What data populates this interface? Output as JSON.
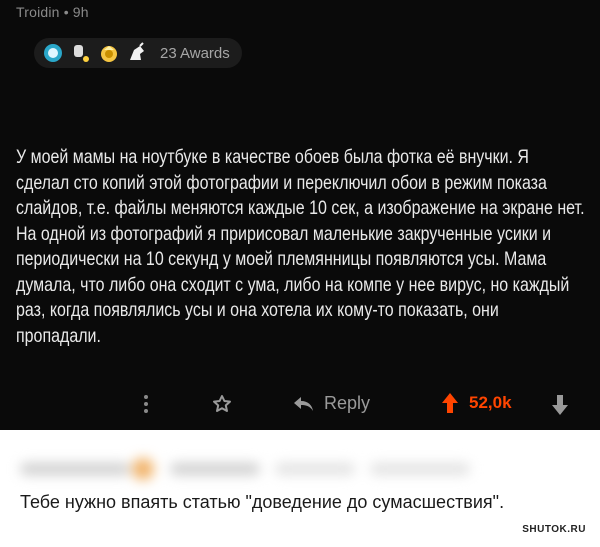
{
  "post": {
    "author": "Troidin",
    "time": "9h",
    "awards_label": "23 Awards",
    "award_icons": [
      "helpful-award-icon",
      "wholesome-award-icon",
      "gold-award-icon",
      "unicorn-award-icon"
    ],
    "body": "У моей мамы на ноутбуке в качестве обоев была фотка её внучки. Я сделал сто копий этой фотографии и переключил обои в режим показа слайдов, т.е. файлы меняются каждые 10 сек, а изображение на экране нет. На одной из фотографий я пририсовал маленькие закрученные усики и периодически на 10 секунд у моей племянницы появляются усы. Мама думала, что либо она сходит с ума, либо на компе у нее вирус, но каждый раз, когда появлялись усы и она хотела их кому-то показать, они пропадали.",
    "actions": {
      "reply_label": "Reply",
      "score": "52,0k"
    },
    "colors": {
      "background": "#0a0a0a",
      "text": "#e9e9e9",
      "meta": "#8a8a8a",
      "upvote": "#ff4500"
    }
  },
  "reply": {
    "text": "Тебе нужно впаять статью \"доведение до сумасшествия\"."
  },
  "watermark": "SHUTOK.RU"
}
